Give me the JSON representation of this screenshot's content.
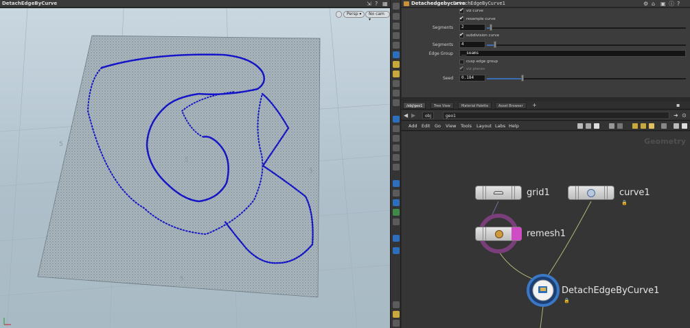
{
  "viewport": {
    "title": "DetachEdgeByCurve",
    "persp_label": "Persp ▾",
    "cam_label": "No cam ▾",
    "grid_marks": [
      "5",
      "5",
      "5",
      "5"
    ]
  },
  "params": {
    "node_type": "Detachedgebycurve",
    "node_name": "DetachEdgeByCurve1",
    "viz_curve": "viz curve",
    "resample_curve": "resample curve",
    "segments_label": "Segments",
    "segments_value": "2",
    "subdivision_curve": "subdivision curve",
    "segments2_label": "Segments",
    "segments2_value": "4",
    "edge_group_label": "Edge Group",
    "edge_group_value": "__seams",
    "cusp_edge_group": "cusp edge group",
    "viz_pieces": "viz pieces",
    "seed_label": "Seed",
    "seed_value": "0.184",
    "segments_fraction": 0.02,
    "segments2_fraction": 0.04,
    "seed_fraction": 0.18
  },
  "network": {
    "tabs": [
      "/obj/geo1",
      "Tree View",
      "Material Palette",
      "Asset Browser"
    ],
    "path": [
      "obj",
      "geo1"
    ],
    "menu": [
      "Add",
      "Edit",
      "Go",
      "View",
      "Tools",
      "Layout",
      "Labs",
      "Help"
    ],
    "context_label": "Geometry",
    "nodes": {
      "grid": "grid1",
      "curve": "curve1",
      "remesh": "remesh1",
      "detach": "DetachEdgeByCurve1"
    }
  },
  "colors": {
    "curve_blue": "#1414c8",
    "accent_blue": "#2e6fbd",
    "remesh_ring": "#7a3e7a"
  }
}
